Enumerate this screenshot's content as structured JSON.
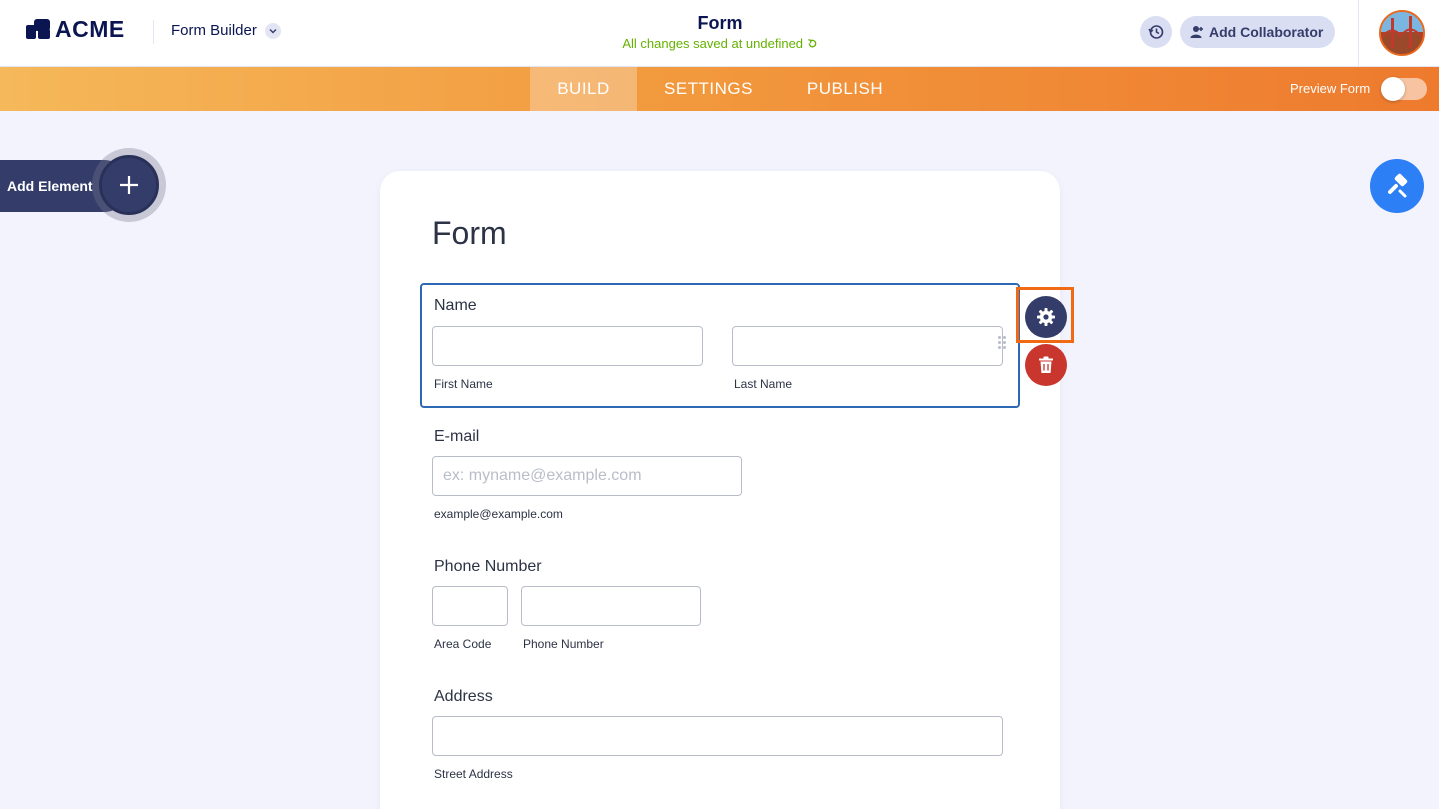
{
  "header": {
    "logo_text": "ACME",
    "app_switch_label": "Form Builder",
    "title": "Form",
    "save_status": "All changes saved at undefined",
    "add_collaborator_label": "Add Collaborator"
  },
  "navbar": {
    "tabs": [
      {
        "label": "BUILD",
        "active": true
      },
      {
        "label": "SETTINGS",
        "active": false
      },
      {
        "label": "PUBLISH",
        "active": false
      }
    ],
    "preview_label": "Preview Form",
    "preview_enabled": false
  },
  "sidebar": {
    "add_element_label": "Add Element"
  },
  "form": {
    "title": "Form",
    "fields": {
      "name": {
        "label": "Name",
        "first_sublabel": "First Name",
        "last_sublabel": "Last Name"
      },
      "email": {
        "label": "E-mail",
        "placeholder": "ex: myname@example.com",
        "sublabel": "example@example.com"
      },
      "phone": {
        "label": "Phone Number",
        "area_sublabel": "Area Code",
        "number_sublabel": "Phone Number"
      },
      "address": {
        "label": "Address",
        "street_sublabel": "Street Address"
      }
    }
  },
  "colors": {
    "accent_orange": "#f06a14",
    "primary_navy": "#343c6a",
    "selection_blue": "#2e69b3",
    "delete_red": "#c8362d",
    "designer_blue": "#2d7ff5",
    "success_green": "#64b200"
  },
  "icons": {
    "history": "history-icon",
    "add_user": "add-user-icon",
    "plus": "plus-icon",
    "paint": "paint-roller-icon",
    "gear": "gear-icon",
    "trash": "trash-icon",
    "refresh": "refresh-icon",
    "drag": "drag-handle-icon"
  }
}
